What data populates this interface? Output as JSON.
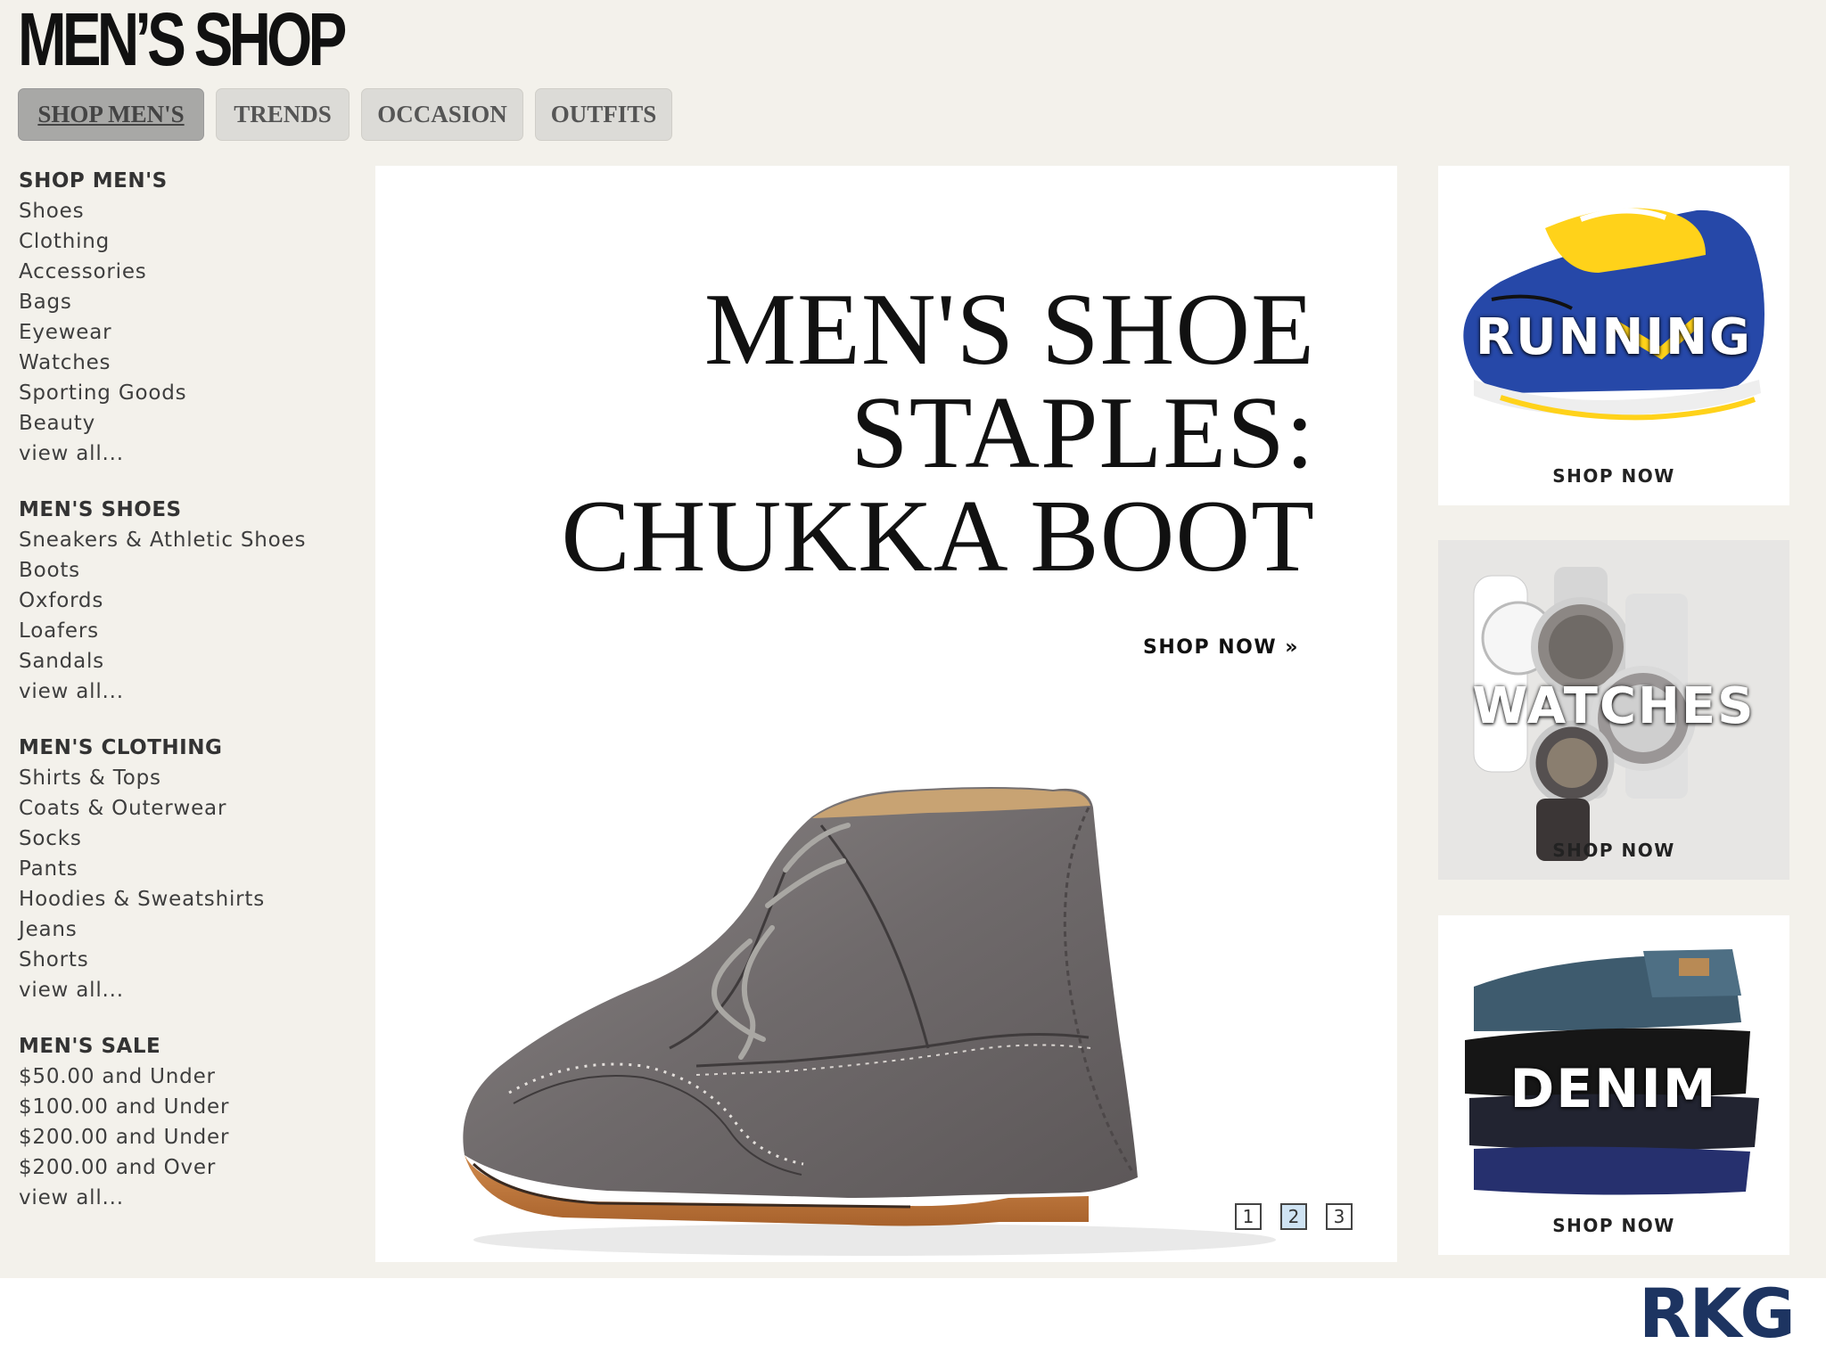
{
  "header": {
    "title": "MEN’S SHOP"
  },
  "tabs": [
    {
      "label": "SHOP MEN'S",
      "active": true
    },
    {
      "label": "TRENDS",
      "active": false
    },
    {
      "label": "OCCASION",
      "active": false
    },
    {
      "label": "OUTFITS",
      "active": false
    }
  ],
  "sidebar": {
    "groups": [
      {
        "heading": "SHOP MEN'S",
        "links": [
          "Shoes",
          "Clothing",
          "Accessories",
          "Bags",
          "Eyewear",
          "Watches",
          "Sporting Goods",
          "Beauty",
          "view all..."
        ]
      },
      {
        "heading": "MEN'S SHOES",
        "links": [
          "Sneakers & Athletic Shoes",
          "Boots",
          "Oxfords",
          "Loafers",
          "Sandals",
          "view all..."
        ]
      },
      {
        "heading": "MEN'S CLOTHING",
        "links": [
          "Shirts & Tops",
          "Coats & Outerwear",
          "Socks",
          "Pants",
          "Hoodies & Sweatshirts",
          "Jeans",
          "Shorts",
          "view all..."
        ]
      },
      {
        "heading": "MEN'S SALE",
        "links": [
          "$50.00 and Under",
          "$100.00 and Under",
          "$200.00 and Under",
          "$200.00 and Over",
          "view all..."
        ]
      }
    ]
  },
  "hero": {
    "headline": [
      "MEN'S SHOE",
      "STAPLES:",
      "CHUKKA BOOT"
    ],
    "cta": "SHOP NOW »",
    "pages": [
      "1",
      "2",
      "3"
    ],
    "selected_page": "2"
  },
  "promos": [
    {
      "label": "RUNNING",
      "cta": "SHOP NOW"
    },
    {
      "label": "WATCHES",
      "cta": "SHOP NOW"
    },
    {
      "label": "DENIM",
      "cta": "SHOP NOW"
    }
  ],
  "brand": "RKG"
}
